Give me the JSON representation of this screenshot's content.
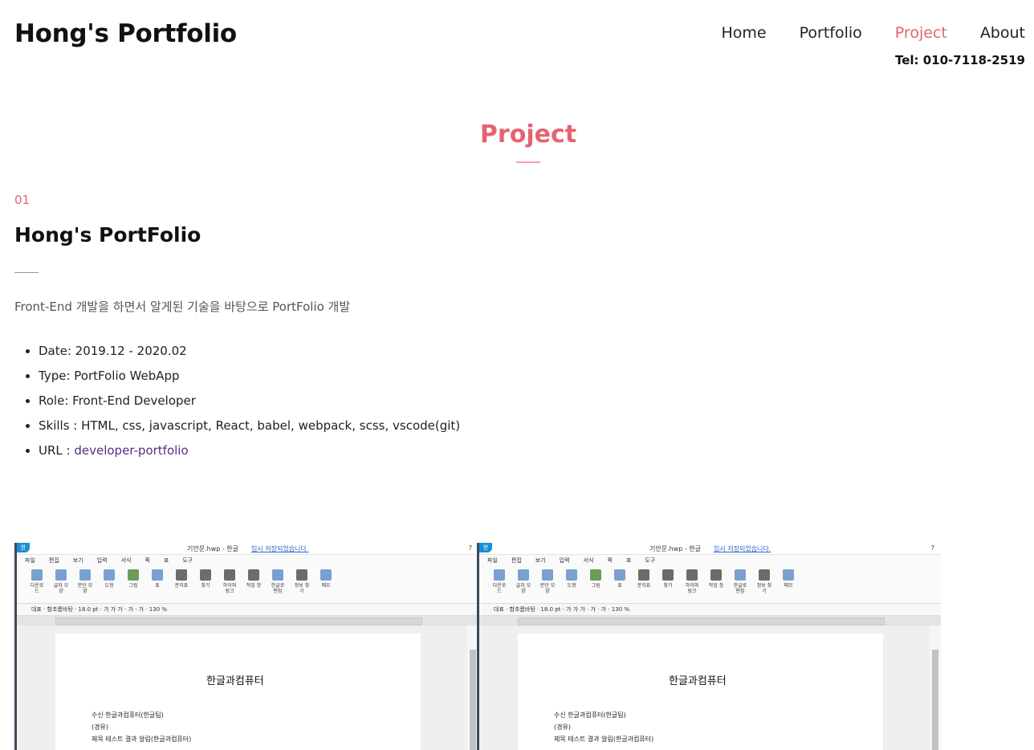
{
  "header": {
    "logo": "Hong's Portfolio",
    "nav": [
      "Home",
      "Portfolio",
      "Project",
      "About"
    ],
    "active_nav": "Project",
    "tel": "Tel: 010-7118-2519"
  },
  "section": {
    "title": "Project"
  },
  "project": {
    "number": "01",
    "title": "Hong's PortFolio",
    "description": "Front-End 개발을 하면서 알게된 기술을 바탕으로 PortFolio 개발",
    "details": [
      "Date: 2019.12 - 2020.02",
      "Type: PortFolio WebApp",
      "Role: Front-End Developer",
      "Skills : HTML, css, javascript, React, babel, webpack, scss, vscode(git)"
    ],
    "url_prefix": "URL : ",
    "url_label": "developer-portfolio"
  },
  "screenshot": {
    "window_title": "기안문.hwp - 한글",
    "save_message": "임시 저장되었습니다.",
    "help": "?",
    "menus": [
      "파일",
      "편집",
      "보기",
      "입력",
      "서식",
      "쪽",
      "표",
      "도구"
    ],
    "ribbon": [
      "다운로드",
      "글자 모양",
      "문단 모양",
      "도형",
      "그림",
      "표",
      "문자표",
      "찾기",
      "하이퍼링크",
      "작업 창",
      "한글로 편집",
      "정보 찾기",
      "메모"
    ],
    "format_bar": "대표  ·  함초롬바탕  ·  18.0  pt  ·  가 가 가 · 가 · 가  ·  130  %",
    "doc_title": "한글과컴퓨터",
    "doc_lines": [
      "수신   한글과컴퓨터(한글팀)",
      "(경유)",
      "제목   테스트 결과 알림(한글과컴퓨터)"
    ]
  }
}
